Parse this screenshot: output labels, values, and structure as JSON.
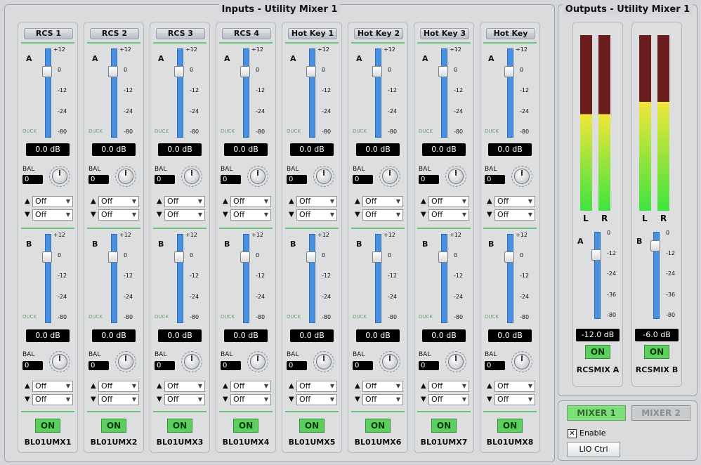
{
  "inputs_title": "Inputs - Utility Mixer 1",
  "outputs_title": "Outputs - Utility Mixer 1",
  "fader_ticks": [
    "+12",
    "0",
    "-12",
    "-24",
    "-80"
  ],
  "out_ticks": [
    "0",
    "-12",
    "-24",
    "-36",
    "-80"
  ],
  "duck": "DUCK",
  "bal_label": "BAL",
  "on_label": "ON",
  "bus_a": "A",
  "bus_b": "B",
  "channels": [
    {
      "label": "RCS 1",
      "name": "BL01UMX1",
      "a_db": "0.0 dB",
      "b_db": "0.0 dB",
      "a_bal": "0",
      "b_bal": "0",
      "a_up": "Off",
      "a_dn": "Off",
      "b_up": "Off",
      "b_dn": "Off"
    },
    {
      "label": "RCS 2",
      "name": "BL01UMX2",
      "a_db": "0.0 dB",
      "b_db": "0.0 dB",
      "a_bal": "0",
      "b_bal": "0",
      "a_up": "Off",
      "a_dn": "Off",
      "b_up": "Off",
      "b_dn": "Off"
    },
    {
      "label": "RCS 3",
      "name": "BL01UMX3",
      "a_db": "0.0 dB",
      "b_db": "0.0 dB",
      "a_bal": "0",
      "b_bal": "0",
      "a_up": "Off",
      "a_dn": "Off",
      "b_up": "Off",
      "b_dn": "Off"
    },
    {
      "label": "RCS 4",
      "name": "BL01UMX4",
      "a_db": "0.0 dB",
      "b_db": "0.0 dB",
      "a_bal": "0",
      "b_bal": "0",
      "a_up": "Off",
      "a_dn": "Off",
      "b_up": "Off",
      "b_dn": "Off"
    },
    {
      "label": "Hot Key 1",
      "name": "BL01UMX5",
      "a_db": "0.0 dB",
      "b_db": "0.0 dB",
      "a_bal": "0",
      "b_bal": "0",
      "a_up": "Off",
      "a_dn": "Off",
      "b_up": "Off",
      "b_dn": "Off"
    },
    {
      "label": "Hot Key 2",
      "name": "BL01UMX6",
      "a_db": "0.0 dB",
      "b_db": "0.0 dB",
      "a_bal": "0",
      "b_bal": "0",
      "a_up": "Off",
      "a_dn": "Off",
      "b_up": "Off",
      "b_dn": "Off"
    },
    {
      "label": "Hot Key 3",
      "name": "BL01UMX7",
      "a_db": "0.0 dB",
      "b_db": "0.0 dB",
      "a_bal": "0",
      "b_bal": "0",
      "a_up": "Off",
      "a_dn": "Off",
      "b_up": "Off",
      "b_dn": "Off"
    },
    {
      "label": "Hot Key",
      "name": "BL01UMX8",
      "a_db": "0.0 dB",
      "b_db": "0.0 dB",
      "a_bal": "0",
      "b_bal": "0",
      "a_up": "Off",
      "a_dn": "Off",
      "b_up": "Off",
      "b_dn": "Off"
    }
  ],
  "outputs": [
    {
      "bus": "A",
      "name": "RCSMIX A",
      "db": "-12.0 dB",
      "l": "L",
      "r": "R",
      "level_fraction": 0.55
    },
    {
      "bus": "B",
      "name": "RCSMIX B",
      "db": "-6.0 dB",
      "l": "L",
      "r": "R",
      "level_fraction": 0.62
    }
  ],
  "mixer1": "MIXER 1",
  "mixer2": "MIXER 2",
  "enable": "Enable",
  "lio": "LIO Ctrl",
  "colors": {
    "fader": "#4a90e2",
    "on": "#5cd05f",
    "meter_green": "#3fe43f",
    "meter_yellow": "#f2e53a",
    "meter_red": "#6b1d1d"
  }
}
